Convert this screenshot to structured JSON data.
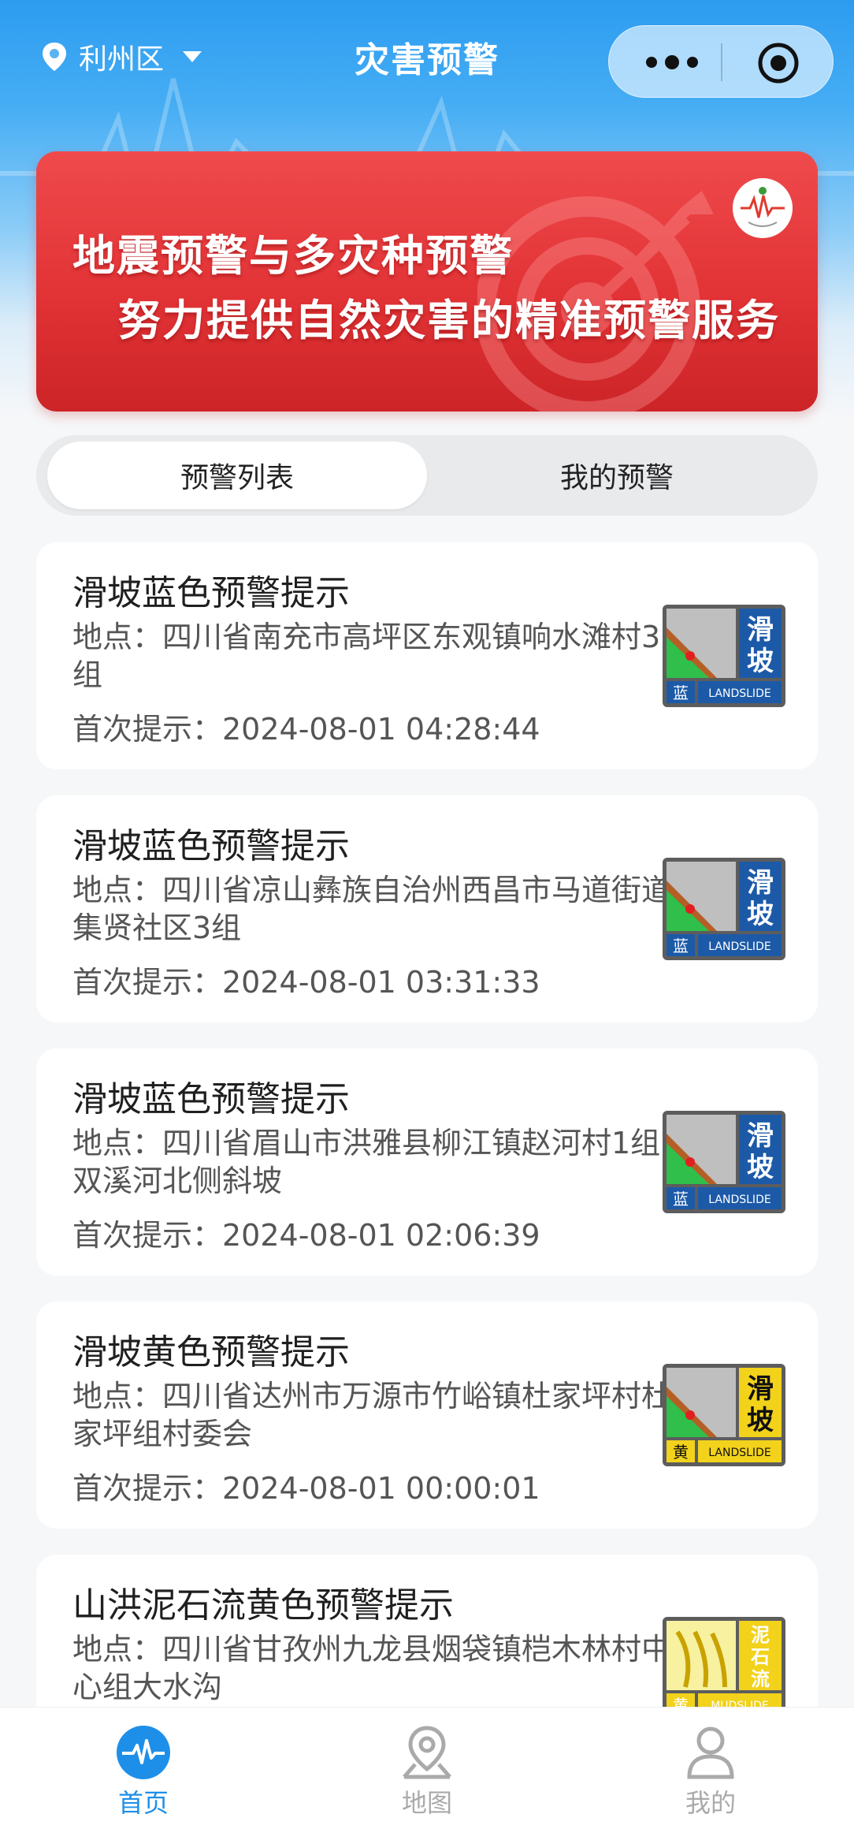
{
  "header": {
    "location": "利州区",
    "title": "灾害预警"
  },
  "banner": {
    "line1": "地震预警与多灾种预警",
    "line2": "努力提供自然灾害的精准预警服务"
  },
  "tabs": [
    {
      "label": "预警列表",
      "active": true
    },
    {
      "label": "我的预警",
      "active": false
    }
  ],
  "alerts": [
    {
      "title": "滑坡蓝色预警提示",
      "address": "地点：四川省南充市高坪区东观镇响水滩村3组",
      "time": "首次提示：2024-08-01 04:28:44",
      "badge": {
        "type": "landslide",
        "level": "蓝",
        "name": "滑坡",
        "english": "LANDSLIDE",
        "color": "#1c5aa8"
      }
    },
    {
      "title": "滑坡蓝色预警提示",
      "address": "地点：四川省凉山彝族自治州西昌市马道街道集贤社区3组",
      "time": "首次提示：2024-08-01 03:31:33",
      "badge": {
        "type": "landslide",
        "level": "蓝",
        "name": "滑坡",
        "english": "LANDSLIDE",
        "color": "#1c5aa8"
      }
    },
    {
      "title": "滑坡蓝色预警提示",
      "address": "地点：四川省眉山市洪雅县柳江镇赵河村1组双溪河北侧斜坡",
      "time": "首次提示：2024-08-01 02:06:39",
      "badge": {
        "type": "landslide",
        "level": "蓝",
        "name": "滑坡",
        "english": "LANDSLIDE",
        "color": "#1c5aa8"
      }
    },
    {
      "title": "滑坡黄色预警提示",
      "address": "地点：四川省达州市万源市竹峪镇杜家坪村杜家坪组村委会",
      "time": "首次提示：2024-08-01 00:00:01",
      "badge": {
        "type": "landslide",
        "level": "黄",
        "name": "滑坡",
        "english": "LANDSLIDE",
        "color": "#f2d21b"
      }
    },
    {
      "title": "山洪泥石流黄色预警提示",
      "address": "地点：四川省甘孜州九龙县烟袋镇桤木林村中心组大水沟",
      "time": "",
      "badge": {
        "type": "mudslide",
        "level": "黄",
        "name": "泥石流",
        "english": "MUDSLIDE",
        "color": "#f2d21b"
      }
    }
  ],
  "tabbar": [
    {
      "label": "首页",
      "icon": "pulse-icon",
      "active": true
    },
    {
      "label": "地图",
      "icon": "map-pin-icon",
      "active": false
    },
    {
      "label": "我的",
      "icon": "user-icon",
      "active": false
    }
  ]
}
